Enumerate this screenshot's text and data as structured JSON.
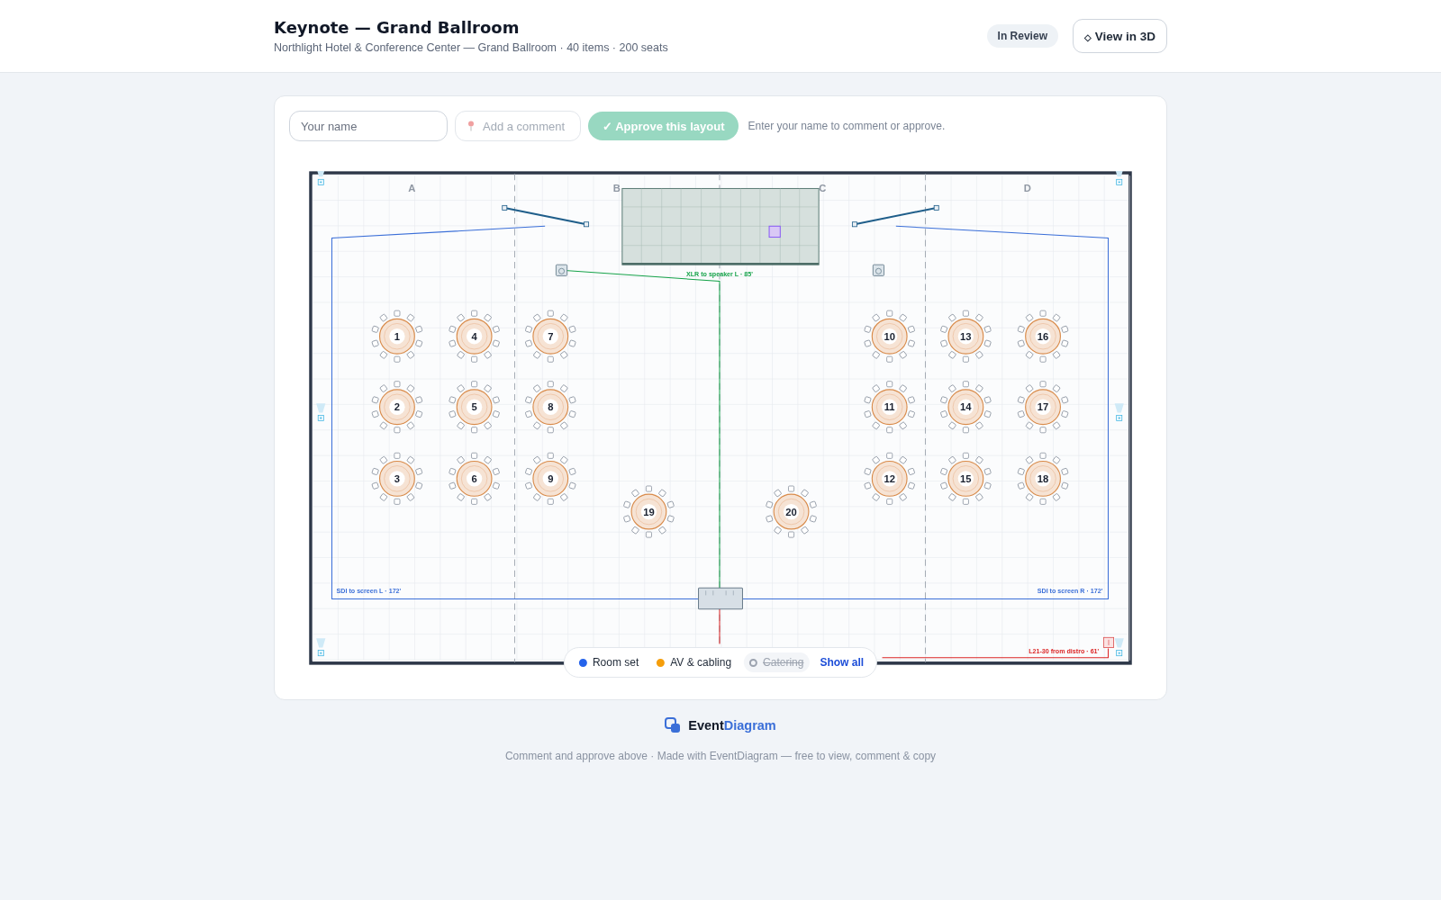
{
  "header": {
    "title": "Keynote — Grand Ballroom",
    "subtitle": "Northlight Hotel & Conference Center — Grand Ballroom · 40 items · 200 seats",
    "status_badge": "In Review",
    "view_3d_button": {
      "icon": "◇",
      "label": "View in 3D"
    }
  },
  "toolbar": {
    "name_field": {
      "placeholder": "Your name"
    },
    "comment_field": {
      "placeholder": "Add a comment",
      "disabled": true
    },
    "approve_button": {
      "label": "✓ Approve this layout",
      "disabled": true
    },
    "hint": "Enter your name to comment or approve."
  },
  "diagram": {
    "zone_labels": [
      "A",
      "B",
      "C",
      "D"
    ],
    "tables": [
      {
        "label": "1"
      },
      {
        "label": "2"
      },
      {
        "label": "3"
      },
      {
        "label": "4"
      },
      {
        "label": "5"
      },
      {
        "label": "6"
      },
      {
        "label": "7"
      },
      {
        "label": "8"
      },
      {
        "label": "9"
      },
      {
        "label": "10"
      },
      {
        "label": "11"
      },
      {
        "label": "12"
      },
      {
        "label": "13"
      },
      {
        "label": "14"
      },
      {
        "label": "15"
      },
      {
        "label": "16"
      },
      {
        "label": "17"
      },
      {
        "label": "18"
      },
      {
        "label": "19"
      },
      {
        "label": "20"
      }
    ],
    "cables": [
      {
        "label": "XLR to speaker L · 85'",
        "color": "#16a34a"
      },
      {
        "label": "SDI to screen L · 172'",
        "color": "#3b6fd8"
      },
      {
        "label": "SDI to screen R · 172'",
        "color": "#3b6fd8"
      },
      {
        "label": "L21-30 from distro · 61'",
        "color": "#dc2626"
      }
    ]
  },
  "legend": {
    "items": [
      {
        "label": "Room set",
        "color": "#2563eb",
        "on": true
      },
      {
        "label": "AV & cabling",
        "color": "#f59e0b",
        "on": true
      },
      {
        "label": "Catering",
        "color": "#9ca3af",
        "on": false
      }
    ],
    "show_all": "Show all"
  },
  "footer": {
    "brand_first": "Event",
    "brand_second": "Diagram",
    "note": "Comment and approve above · Made with EventDiagram — free to view, comment & copy"
  }
}
